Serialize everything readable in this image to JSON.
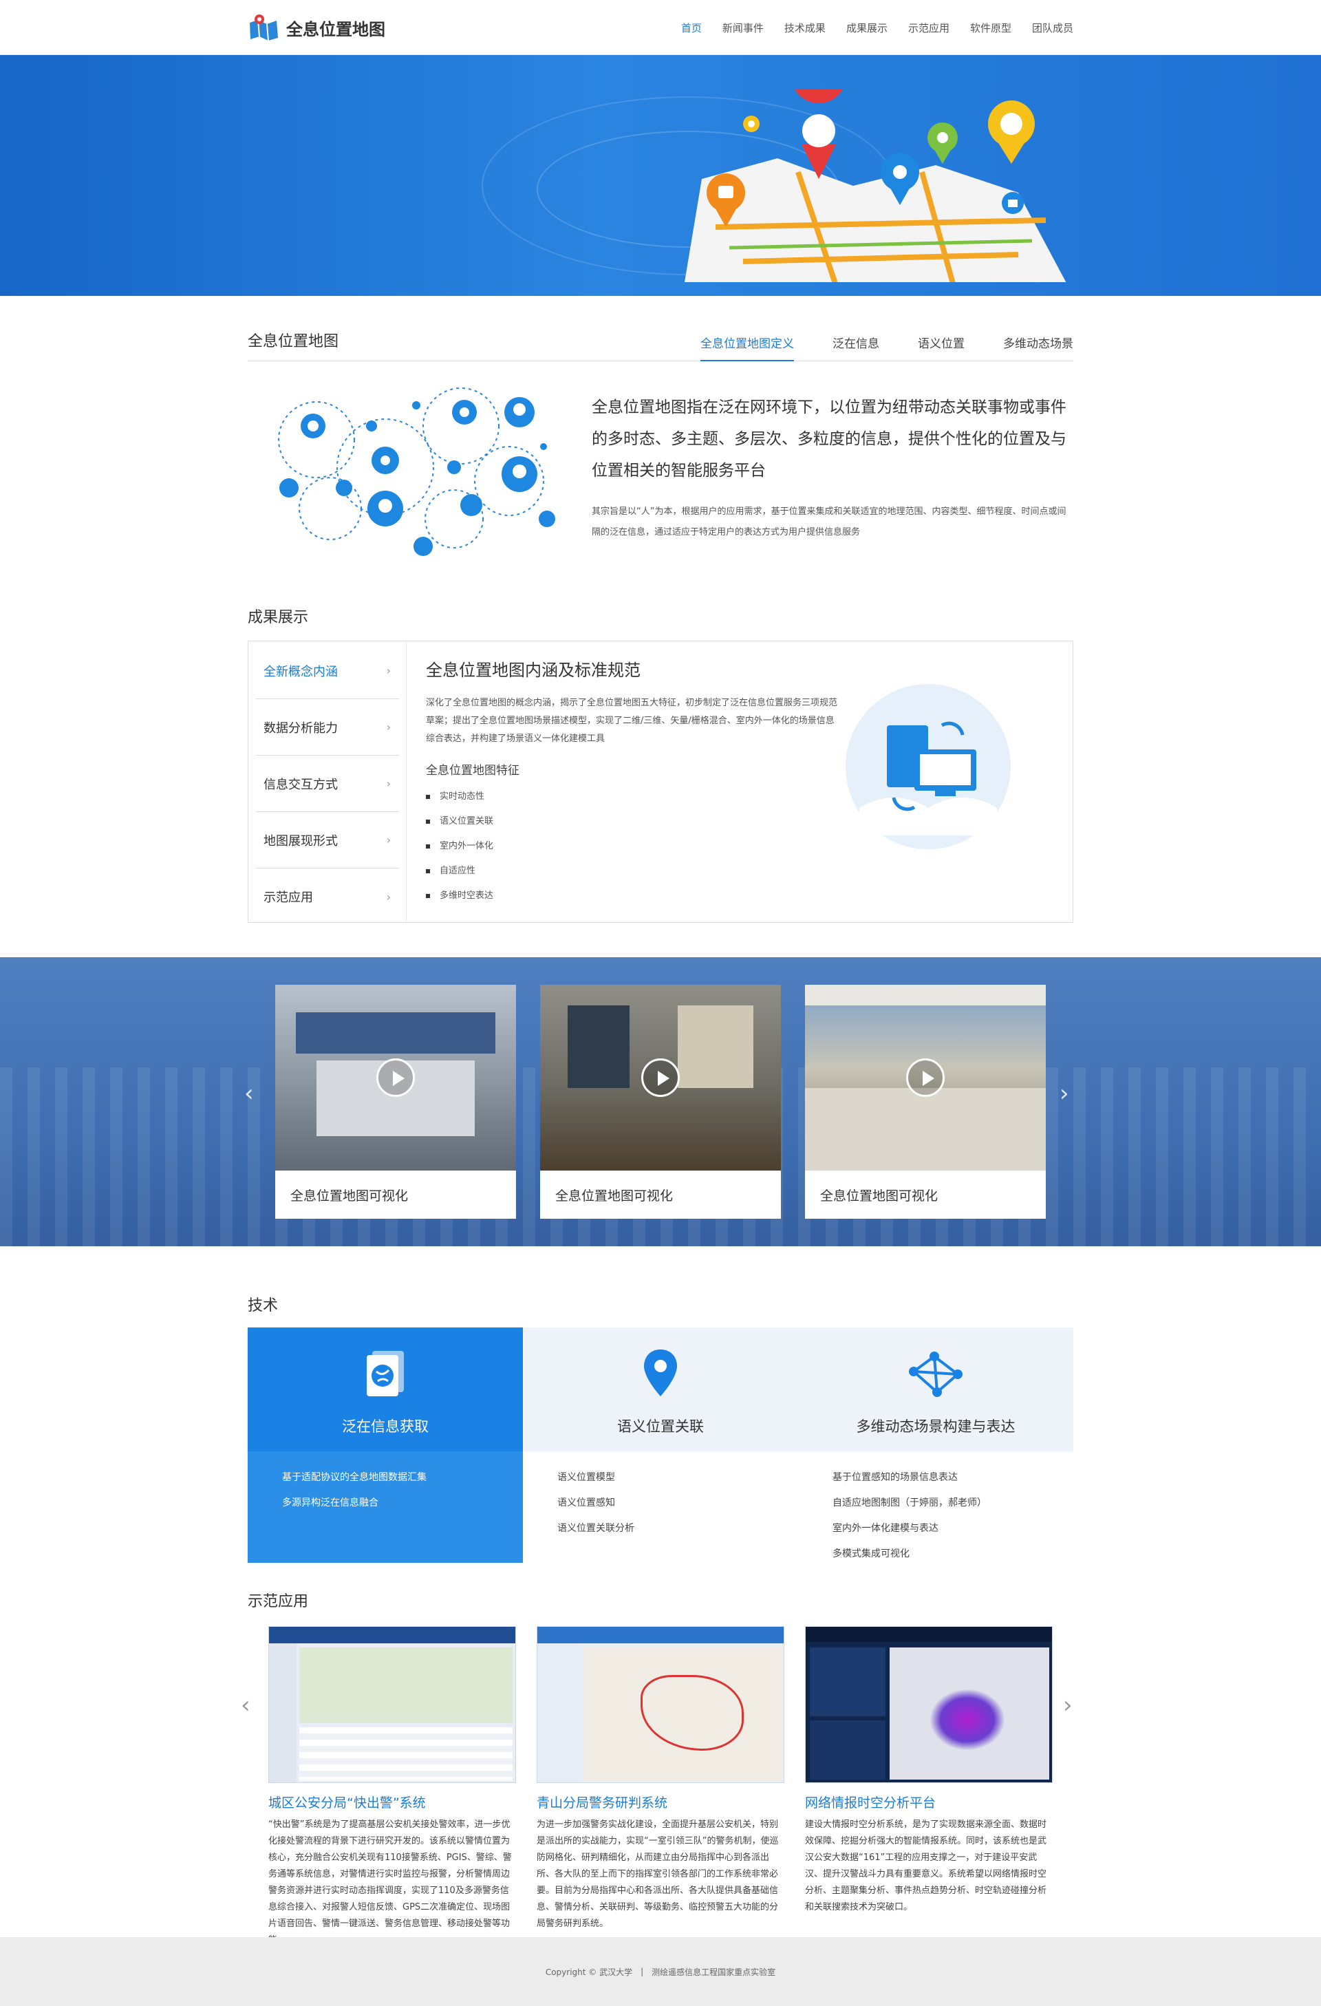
{
  "header": {
    "logo_text": "全息位置地图",
    "nav": [
      "首页",
      "新闻事件",
      "技术成果",
      "成果展示",
      "示范应用",
      "软件原型",
      "团队成员"
    ]
  },
  "banner": {
    "slides": 5,
    "active": 1
  },
  "intro": {
    "title": "全息位置地图",
    "tabs": [
      "全息位置地图定义",
      "泛在信息",
      "语义位置",
      "多维动态场景"
    ],
    "headline": "全息位置地图指在泛在网环境下，以位置为纽带动态关联事物或事件的多时态、多主题、多层次、多粒度的信息，提供个性化的位置及与位置相关的智能服务平台",
    "desc": "其宗旨是以“人”为本，根据用户的应用需求，基于位置来集成和关联适宜的地理范围、内容类型、细节程度、时间点或间隔的泛在信息，通过适应于特定用户的表达方式为用户提供信息服务"
  },
  "achievements": {
    "title": "成果展示",
    "menu": [
      "全新概念内涵",
      "数据分析能力",
      "信息交互方式",
      "地图展现形式",
      "示范应用"
    ],
    "heading": "全息位置地图内涵及标准规范",
    "desc": "深化了全息位置地图的概念内涵，揭示了全息位置地图五大特征，初步制定了泛在信息位置服务三项规范草案；提出了全息位置地图场景描述模型，实现了二维/三维、矢量/栅格混合、室内外一体化的场景信息综合表达，并构建了场景语义一体化建模工具",
    "features_title": "全息位置地图特征",
    "features": [
      "实时动态性",
      "语义位置关联",
      "室内外一体化",
      "自适应性",
      "多维时空表达"
    ]
  },
  "videos": {
    "items": [
      "全息位置地图可视化",
      "全息位置地图可视化",
      "全息位置地图可视化"
    ]
  },
  "tech": {
    "title": "技术",
    "columns": [
      {
        "name": "泛在信息获取",
        "items": [
          "基于适配协议的全息地图数据汇集",
          "多源异构泛在信息融合"
        ]
      },
      {
        "name": "语义位置关联",
        "items": [
          "语义位置模型",
          "语义位置感知",
          "语义位置关联分析"
        ]
      },
      {
        "name": "多维动态场景构建与表达",
        "items": [
          "基于位置感知的场景信息表达",
          "自适应地图制图（于婷丽，郝老师）",
          "室内外一体化建模与表达",
          "多模式集成可视化"
        ]
      }
    ]
  },
  "demo": {
    "title": "示范应用",
    "items": [
      {
        "title": "城区公安分局“快出警”系统",
        "desc": "“快出警”系统是为了提高基层公安机关接处警效率，进一步优化接处警流程的背景下进行研究开发的。该系统以警情位置为核心，充分融合公安机关现有110接警系统、PGIS、警综、警务通等系统信息，对警情进行实时监控与报警，分析警情周边警务资源并进行实时动态指挥调度，实现了110及多源警务信息综合接入、对报警人短信反馈、GPS二次准确定位、现场图片语音回告、警情一键派送、警务信息管理、移动接处警等功能。"
      },
      {
        "title": "青山分局警务研判系统",
        "desc": "为进一步加强警务实战化建设，全面提升基层公安机关，特别是派出所的实战能力，实现“一室引领三队”的警务机制，使巡防网格化、研判精细化，从而建立由分局指挥中心到各派出所、各大队的至上而下的指挥室引领各部门的工作系统非常必要。目前为分局指挥中心和各派出所、各大队提供具备基础信息、警情分析、关联研判、等级勤务、临控预警五大功能的分局警务研判系统。"
      },
      {
        "title": "网络情报时空分析平台",
        "desc": "建设大情报时空分析系统，是为了实现数据来源全面、数据时效保障、挖掘分析强大的智能情报系统。同时，该系统也是武汉公安大数据“161”工程的应用支撑之一，对于建设平安武汉、提升汉警战斗力具有重要意义。系统希望以网络情报时空分析、主题聚集分析、事件热点趋势分析、时空轨迹碰撞分析和关联搜索技术为突破口。"
      }
    ]
  },
  "footer": {
    "copyright": "Copyright © 武汉大学",
    "divider": "|",
    "lab": "测绘遥感信息工程国家重点实验室"
  },
  "colors": {
    "brand": "#1a7cd8",
    "banner": "#1f78d8",
    "tech_active": "#2b8fe8"
  }
}
